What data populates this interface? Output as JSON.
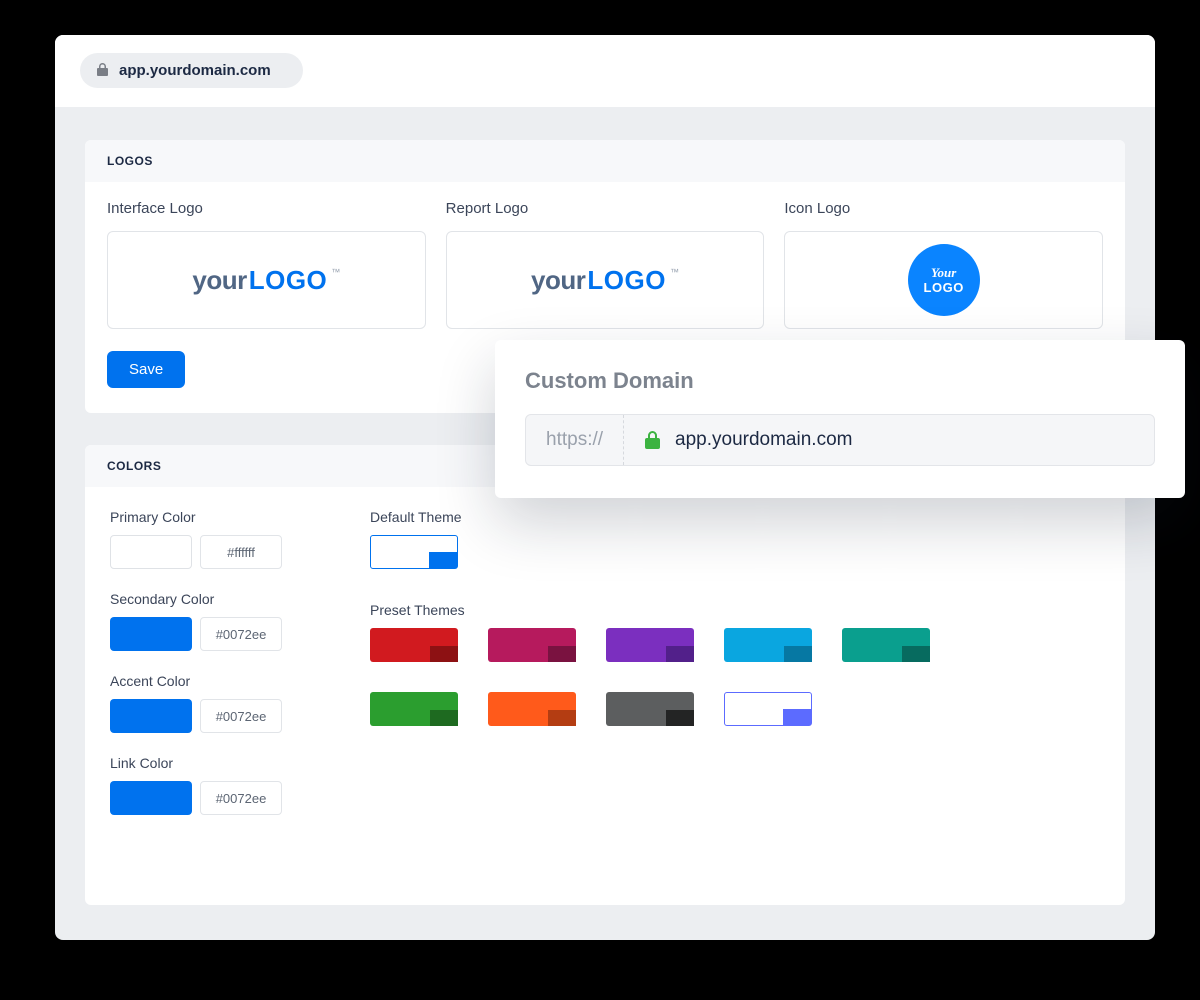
{
  "address_bar": {
    "url": "app.yourdomain.com"
  },
  "logos": {
    "section_title": "LOGOS",
    "interface_label": "Interface Logo",
    "report_label": "Report Logo",
    "icon_label": "Icon Logo",
    "word_your": "your",
    "word_logo": "LOGO",
    "tm": "™",
    "circle_l1": "Your",
    "circle_l2": "LOGO",
    "save_label": "Save"
  },
  "colors": {
    "section_title": "COLORS",
    "primary_label": "Primary Color",
    "primary_hex": "#ffffff",
    "primary_swatch": "#ffffff",
    "secondary_label": "Secondary Color",
    "secondary_hex": "#0072ee",
    "secondary_swatch": "#0072ee",
    "accent_label": "Accent Color",
    "accent_hex": "#0072ee",
    "accent_swatch": "#0072ee",
    "link_label": "Link Color",
    "link_hex": "#0072ee",
    "link_swatch": "#0072ee",
    "default_theme_label": "Default Theme",
    "default_theme": {
      "bg": "#ffffff",
      "accent": "#0072ee"
    },
    "preset_label": "Preset Themes",
    "presets": [
      {
        "bg": "#d11a1f",
        "accent": "#8d1113"
      },
      {
        "bg": "#b61a5d",
        "accent": "#7a1240"
      },
      {
        "bg": "#7b2fbf",
        "accent": "#52208a"
      },
      {
        "bg": "#0aa6e0",
        "accent": "#0678a3"
      },
      {
        "bg": "#0a9f8e",
        "accent": "#076b5f"
      },
      {
        "bg": "#2b9e2f",
        "accent": "#1e6a20"
      },
      {
        "bg": "#ff5a1b",
        "accent": "#b43d12"
      },
      {
        "bg": "#5c5e5f",
        "accent": "#232424"
      },
      {
        "bg": "#ffffff",
        "accent": "#5c6bff",
        "outline": "#5c6bff"
      }
    ]
  },
  "custom_domain": {
    "title": "Custom Domain",
    "protocol": "https://",
    "value": "app.yourdomain.com"
  }
}
